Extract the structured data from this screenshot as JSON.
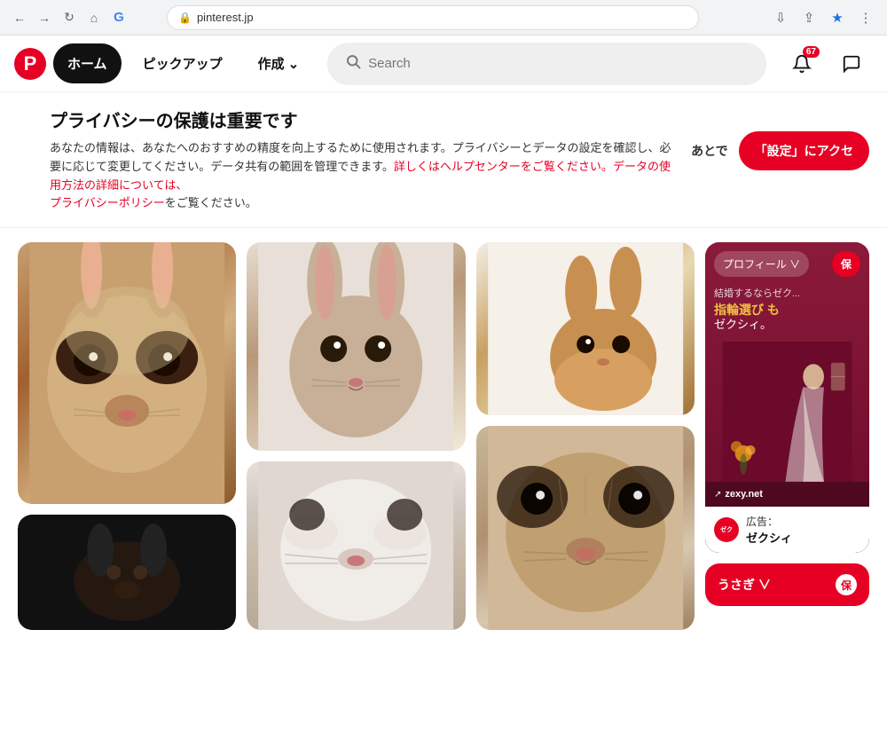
{
  "browser": {
    "url": "pinterest.jp",
    "lock_icon": "🔒",
    "back_icon": "←",
    "forward_icon": "→",
    "refresh_icon": "↻",
    "home_icon": "⌂",
    "notification_count": "67"
  },
  "header": {
    "logo_letter": "P",
    "nav": {
      "home_label": "ホーム",
      "pickup_label": "ピックアップ",
      "create_label": "作成",
      "create_chevron": "∨"
    },
    "search_placeholder": "Search",
    "notification_badge": "67"
  },
  "privacy_banner": {
    "title": "プライバシーの保護は重要です",
    "body_line1": "あなたの情報は、あなたへのおすすめの精度を向上するために使用されます。プライバシーとデータの設定を確認し、必要に応じて変更してください。データ共有の範囲を管理できます。",
    "body_line2_prefix": "詳しくはヘルプセンターをご覧ください。",
    "body_line2_link": "データの使用方法の詳細については、",
    "body_line3_link": "プライバシーポリシー",
    "body_line3_suffix": "をご覧ください。",
    "later_label": "あとで",
    "cta_label": "「設定」にアクセ"
  },
  "ad": {
    "profile_label": "プロフィール ∨",
    "save_label": "保",
    "text_main": "指輪選び も",
    "text_sub": "ゼクシィ。",
    "subtitle": "結婚するならゼク...",
    "link_icon": "↗",
    "link_text": "zexy.net",
    "advertiser_label": "広告：",
    "advertiser_name": "ゼクシィ"
  },
  "category": {
    "label": "うさぎ ∨"
  }
}
